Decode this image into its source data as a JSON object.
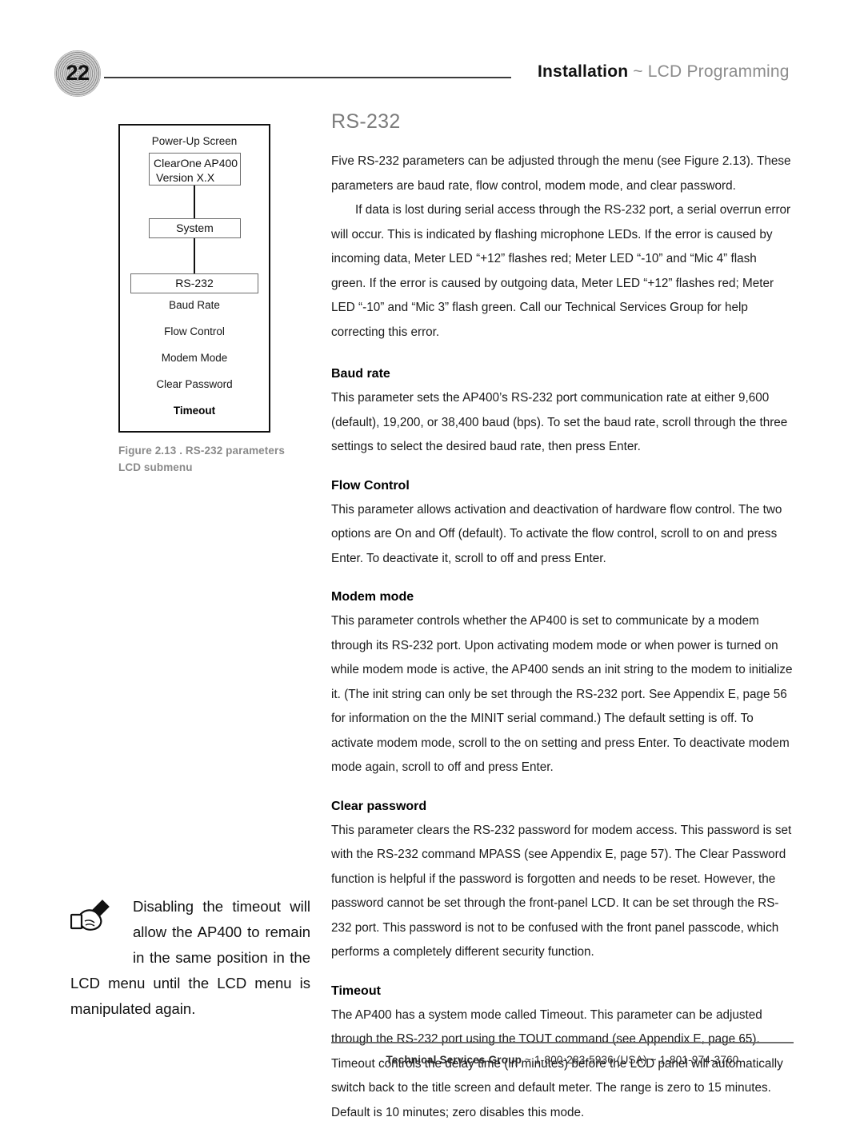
{
  "header": {
    "page_number": "22",
    "title_strong": "Installation",
    "title_muted": "~ LCD Programming"
  },
  "figure": {
    "powerup_label": "Power-Up Screen",
    "node_powerup_line1": "ClearOne   AP400",
    "node_powerup_line2": "Version X.X",
    "node_system": "System",
    "node_rs232": "RS-232",
    "items": [
      "Baud Rate",
      "Flow Control",
      "Modem Mode",
      "Clear Password",
      "Timeout"
    ],
    "caption_line1": "Figure 2.13 . RS-232 parameters",
    "caption_line2": "LCD submenu"
  },
  "note": {
    "icon": "writing-hand-icon",
    "text": "Disabling the timeout will allow the AP400 to remain in the same position in the LCD menu until the LCD menu is manipulated again."
  },
  "main": {
    "heading": "RS-232",
    "intro_paragraph": "Five RS-232 parameters can be adjusted through the menu (see Figure 2.13). These parameters are baud rate, flow control, modem mode, and clear password.",
    "error_paragraph": "If data is lost during serial access through the RS-232 port, a serial overrun error will occur. This is indicated by flashing microphone LEDs. If the error is caused by incoming data, Meter LED “+12” flashes red; Meter LED “-10” and “Mic 4” flash green. If the error is caused by outgoing data, Meter LED “+12” flashes red; Meter LED “-10” and “Mic 3” flash green. Call our Technical Services Group for help correcting this error.",
    "sections": [
      {
        "heading": "Baud rate",
        "body": "This parameter sets the AP400’s RS-232 port communication rate at either 9,600 (default), 19,200, or 38,400 baud (bps). To set the baud rate, scroll through the three settings to select the desired baud rate, then press Enter."
      },
      {
        "heading": "Flow Control",
        "body": "This parameter allows activation and deactivation of hardware flow control. The two options are On and Off (default). To activate the flow control, scroll to on and press Enter. To deactivate it, scroll to off and press Enter."
      },
      {
        "heading": "Modem mode",
        "body": "This parameter controls whether the AP400 is set to communicate by a modem through its RS-232 port. Upon activating modem mode or when power is turned on while modem mode is active, the AP400 sends an init string to the modem to initialize it. (The init string can only be set through the RS-232 port. See Appendix E, page 56 for information on the the MINIT serial command.) The default setting is off. To activate modem mode, scroll to the on setting and press Enter. To deactivate modem mode again, scroll to off and press Enter."
      },
      {
        "heading": "Clear password",
        "body": "This parameter clears the RS-232 password for modem access. This password is set with the RS-232 command MPASS (see Appendix E, page 57). The Clear Password function is helpful if the password is forgotten and needs to be reset. However, the password cannot be set through the front-panel LCD. It can be set through the RS-232 port. This password is not to be confused with the front panel passcode, which performs a completely different security function."
      },
      {
        "heading": "Timeout",
        "body": "The AP400 has a system mode called Timeout. This parameter can be adjusted through the RS-232 port using the TOUT command (see Appendix E, page 65). Timeout controls the delay time (in minutes) before the LCD panel will automatically switch back to the title screen and default meter. The range is zero to 15 minutes. Default is 10 minutes; zero disables this mode."
      }
    ]
  },
  "footer": {
    "group": "Technical Services Group",
    "contact": "~ 1-800-283-5936 (USA) ~ 1-801-974-3760"
  }
}
